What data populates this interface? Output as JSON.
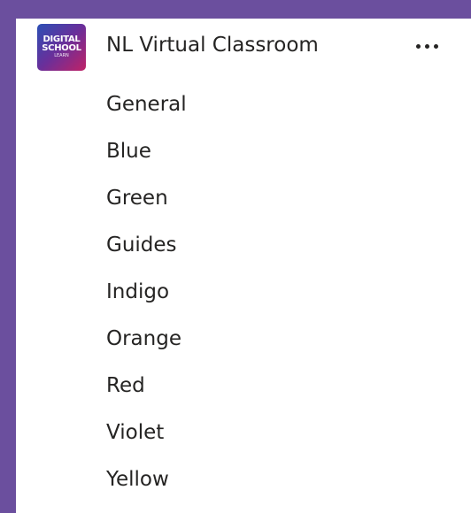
{
  "team": {
    "name": "NL Virtual Classroom",
    "logo": {
      "line1": "DIGITAL",
      "line2": "SCHOOL",
      "line3": "LEARN",
      "colors": [
        "#2b4fb5",
        "#6a2f9a",
        "#c02266"
      ]
    },
    "more_icon": "more-horizontal-icon"
  },
  "channels": [
    {
      "label": "General"
    },
    {
      "label": "Blue"
    },
    {
      "label": "Green"
    },
    {
      "label": "Guides"
    },
    {
      "label": "Indigo"
    },
    {
      "label": "Orange"
    },
    {
      "label": "Red"
    },
    {
      "label": "Violet"
    },
    {
      "label": "Yellow"
    }
  ],
  "colors": {
    "frame": "#6b4f9e",
    "panel": "#ffffff",
    "text": "#252423"
  }
}
